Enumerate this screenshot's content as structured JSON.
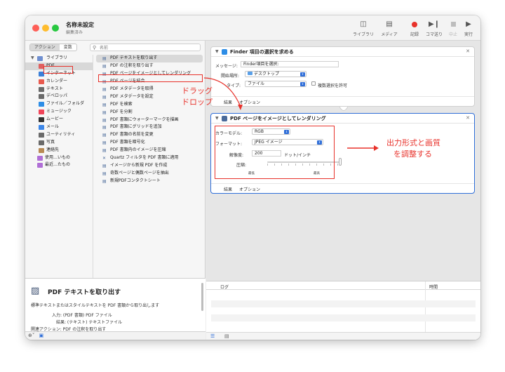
{
  "window": {
    "title": "名称未設定",
    "subtitle": "編集済み"
  },
  "toolbar": {
    "library": "ライブラリ",
    "media": "メディア",
    "record": "記録",
    "step": "コマ送り",
    "stop": "中止",
    "run": "実行"
  },
  "left": {
    "tab_actions": "アクション",
    "tab_variables": "変数",
    "search_placeholder": "名前",
    "library_items": [
      {
        "label": "ライブラリ",
        "icon": "library-folder-icon",
        "color": "#6f8fd0"
      },
      {
        "label": "PDF",
        "icon": "pdf-icon",
        "color": "#e06060"
      },
      {
        "label": "インターネット",
        "icon": "globe-icon",
        "color": "#3b7fd8"
      },
      {
        "label": "カレンダー",
        "icon": "calendar-icon",
        "color": "#e85a4f"
      },
      {
        "label": "テキスト",
        "icon": "text-icon",
        "color": "#6a6a6a"
      },
      {
        "label": "デベロッパ",
        "icon": "hammer-icon",
        "color": "#6a6a6a"
      },
      {
        "label": "ファイル／フォルダ",
        "icon": "finder-icon",
        "color": "#2d8de6"
      },
      {
        "label": "ミュージック",
        "icon": "music-icon",
        "color": "#f0455a"
      },
      {
        "label": "ムービー",
        "icon": "movie-icon",
        "color": "#333333"
      },
      {
        "label": "メール",
        "icon": "mail-icon",
        "color": "#3d87e8"
      },
      {
        "label": "ユーティリティ",
        "icon": "tools-icon",
        "color": "#6a6a6a"
      },
      {
        "label": "写真",
        "icon": "photos-icon",
        "color": "#6a6a6a"
      },
      {
        "label": "連絡先",
        "icon": "contacts-icon",
        "color": "#b88a54"
      },
      {
        "label": "使用…いもの",
        "icon": "smart-folder-icon",
        "color": "#b06fd6"
      },
      {
        "label": "最近…たもの",
        "icon": "smart-folder-icon",
        "color": "#b06fd6"
      }
    ],
    "actions": [
      "PDF テキストを取り出す",
      "PDF の注釈を取り出す",
      "PDF ページをイメージとしてレンダリング",
      "PDF ページを結合",
      "PDF メタデータを取得",
      "PDF メタデータを設定",
      "PDF を検索",
      "PDF を分割",
      "PDF 書類にウォーターマークを描画",
      "PDF 書類にグリッドを追加",
      "PDF 書類の名前を変更",
      "PDF 書類を暗号化",
      "PDF 書類内のイメージを圧縮",
      "Quartz フィルタを PDF 書類に適用",
      "イメージから新規 PDF を作成",
      "奇数ページと偶数ページを抽出",
      "新規PDFコンタクトシート"
    ],
    "description": {
      "title": "PDF テキストを取り出す",
      "text": "標準テキストまたはスタイルテキストを PDF 書類から取り出します",
      "input": "入力: (PDF 書類) PDF ファイル",
      "output": "結果: (テキスト) テキストファイル",
      "related": "関連アクション: PDF の注釈を取り出す"
    }
  },
  "card1": {
    "title": "Finder 項目の選択を求める",
    "message_label": "メッセージ:",
    "message_value": "Finder項目を選択:",
    "start_label": "開始場所:",
    "start_value": "デスクトップ",
    "type_label": "タイプ:",
    "type_value": "ファイル",
    "multi_label": "複数選択を許可",
    "tab_results": "結果",
    "tab_options": "オプション"
  },
  "card2": {
    "title": "PDF ページをイメージとしてレンダリング",
    "color_label": "カラーモデル:",
    "color_value": "RGB",
    "format_label": "フォーマット:",
    "format_value": "JPEG イメージ",
    "res_label": "解像度:",
    "res_value": "200",
    "res_unit": "ドット/インチ",
    "comp_label": "圧縮:",
    "comp_min": "最低",
    "comp_max": "最高",
    "compression_level": 1.0,
    "tab_results": "結果",
    "tab_options": "オプション"
  },
  "log": {
    "col_log": "ログ",
    "col_time": "時間"
  },
  "annotations": {
    "drag": "ドラッグ",
    "drop": "ドロップ",
    "adjust_line1": "出力形式と画質",
    "adjust_line2": "を調整する",
    "color": "#e8322b"
  }
}
